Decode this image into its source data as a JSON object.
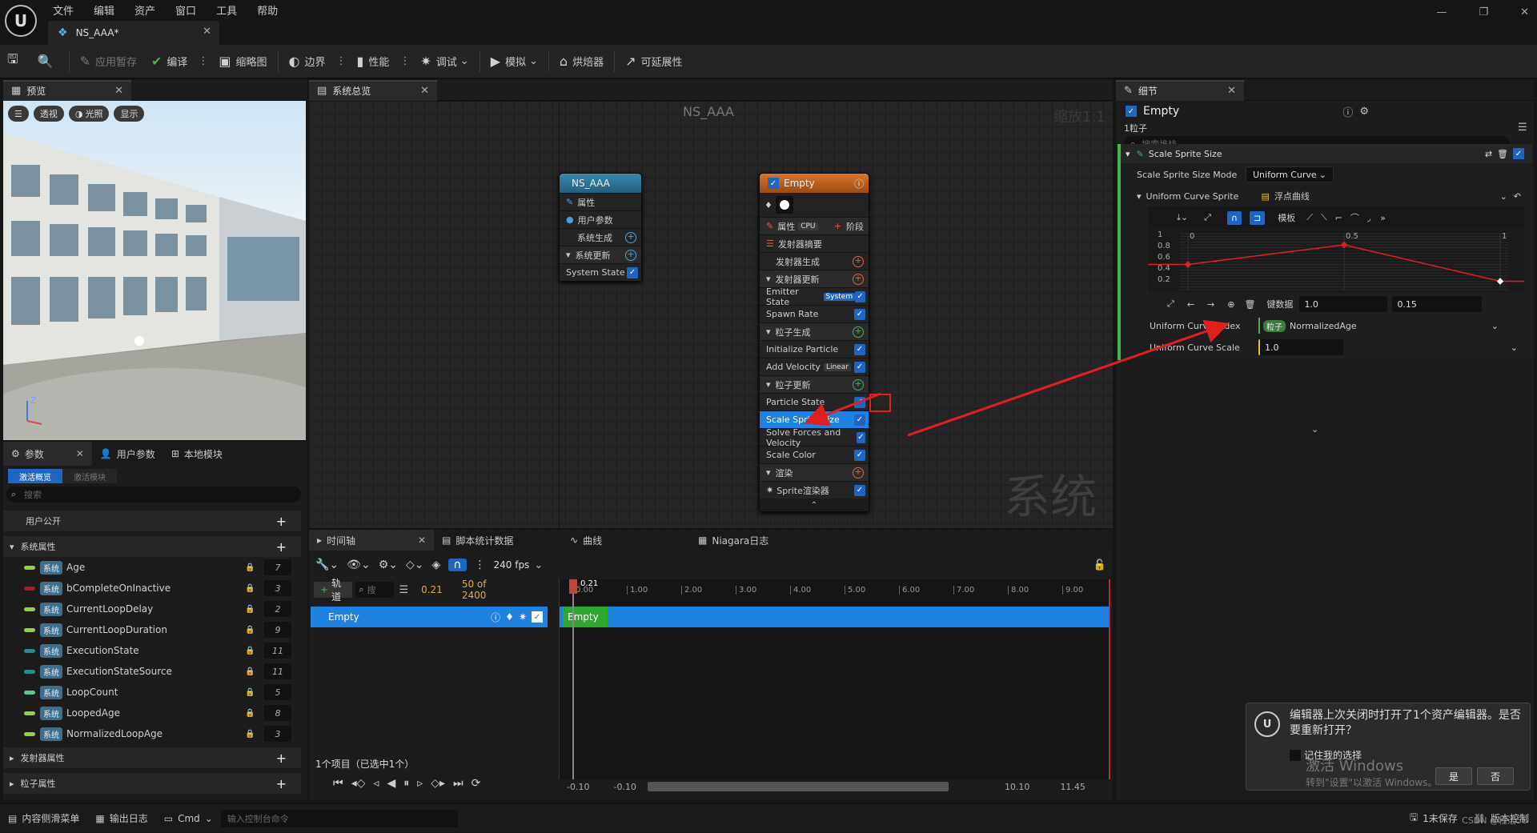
{
  "menu": [
    "文件",
    "编辑",
    "资产",
    "窗口",
    "工具",
    "帮助"
  ],
  "doc_tab": "NS_AAA*",
  "toolbar": [
    {
      "label": "应用暂存",
      "icon": "apply-icon",
      "dim": true
    },
    {
      "label": "编译",
      "icon": "compile-icon",
      "dim": false
    },
    {
      "label": "缩略图",
      "icon": "thumbnail-icon",
      "dim": false
    },
    {
      "label": "边界",
      "icon": "bounds-icon",
      "dim": false
    },
    {
      "label": "性能",
      "icon": "performance-icon",
      "dim": false
    },
    {
      "label": "调试",
      "icon": "debug-icon",
      "dim": false
    },
    {
      "label": "模拟",
      "icon": "simulate-icon",
      "dim": false
    },
    {
      "label": "烘焙器",
      "icon": "baker-icon",
      "dim": false
    },
    {
      "label": "可延展性",
      "icon": "scalability-icon",
      "dim": false
    }
  ],
  "preview": {
    "tab": "预览",
    "buttons": [
      "透视",
      "光照",
      "显示"
    ],
    "axis_z": "Z"
  },
  "params": {
    "tabs": [
      "参数",
      "用户参数",
      "本地模块"
    ],
    "subtabs": [
      "激活概览",
      "激活模块"
    ],
    "search_placeholder": "搜索",
    "sections": [
      "用户公开",
      "系统属性",
      "发射器属性",
      "粒子属性"
    ],
    "tag": "系统",
    "rows": [
      {
        "name": "Age",
        "value": "7",
        "color": "#8bd34a"
      },
      {
        "name": "bCompleteOnInactive",
        "value": "3",
        "color": "#b01a1a"
      },
      {
        "name": "CurrentLoopDelay",
        "value": "2",
        "color": "#8bd34a"
      },
      {
        "name": "CurrentLoopDuration",
        "value": "9",
        "color": "#8bd34a"
      },
      {
        "name": "ExecutionState",
        "value": "11",
        "color": "#1f8f8f"
      },
      {
        "name": "ExecutionStateSource",
        "value": "11",
        "color": "#1f8f8f"
      },
      {
        "name": "LoopCount",
        "value": "5",
        "color": "#4ad38b"
      },
      {
        "name": "LoopedAge",
        "value": "8",
        "color": "#8bd34a"
      },
      {
        "name": "NormalizedLoopAge",
        "value": "3",
        "color": "#8bd34a"
      }
    ]
  },
  "graph": {
    "tab": "系统总览",
    "title": "NS_AAA",
    "zoom": "缩放1:1",
    "watermark": "系统",
    "system_node": {
      "title": "NS_AAA",
      "rows": [
        "属性",
        "用户参数",
        "系统生成",
        "系统更新",
        "System State"
      ]
    },
    "emitter_node": {
      "title": "Empty",
      "props": "属性",
      "cpu": "CPU",
      "stage": "阶段",
      "summary": "发射器摘要",
      "rows": [
        {
          "label": "发射器生成",
          "kind": "section-o"
        },
        {
          "label": "发射器更新",
          "kind": "head-o"
        },
        {
          "label": "Emitter State",
          "badge": "System",
          "kind": "check"
        },
        {
          "label": "Spawn Rate",
          "kind": "check"
        },
        {
          "label": "粒子生成",
          "kind": "head-g"
        },
        {
          "label": "Initialize Particle",
          "kind": "check"
        },
        {
          "label": "Add Velocity",
          "badge2": "Linear",
          "kind": "check"
        },
        {
          "label": "粒子更新",
          "kind": "head-g"
        },
        {
          "label": "Particle State",
          "kind": "check"
        },
        {
          "label": "Scale Sprite Size",
          "kind": "selected"
        },
        {
          "label": "Solve Forces and Velocity",
          "kind": "check"
        },
        {
          "label": "Scale Color",
          "kind": "check"
        },
        {
          "label": "渲染",
          "kind": "head-o"
        },
        {
          "label": "Sprite渲染器",
          "kind": "check"
        }
      ]
    }
  },
  "timeline": {
    "tabs": [
      "时间轴",
      "脚本统计数据",
      "曲线",
      "Niagara日志"
    ],
    "fps": "240 fps",
    "track_btn": "轨道",
    "search": "搜",
    "time": "0.21",
    "frames": "50 of 2400",
    "playhead": "0.21",
    "ticks": [
      "0.00",
      "1.00",
      "2.00",
      "3.00",
      "4.00",
      "5.00",
      "6.00",
      "7.00",
      "8.00",
      "9.00"
    ],
    "track": "Empty",
    "bar": "Empty",
    "items": "1个项目（已选中1个）",
    "range": [
      "-0.10",
      "-0.10",
      "10.10",
      "11.45"
    ]
  },
  "details": {
    "tab": "细节",
    "title": "Empty",
    "sub": "1粒子",
    "search_placeholder": "搜索堆栈",
    "module": "Scale Sprite Size",
    "mode_label": "Scale Sprite Size Mode",
    "mode_value": "Uniform Curve",
    "curve_label": "Uniform Curve Sprite",
    "curve_value": "浮点曲线",
    "template": "模板",
    "y_ticks": [
      "1",
      "0.8",
      "0.6",
      "0.4",
      "0.2"
    ],
    "x_ticks": [
      "0",
      "0.5",
      "1"
    ],
    "key_label": "键数据",
    "key_time": "1.0",
    "key_value": "0.15",
    "index_label": "Uniform Curve Index",
    "index_tag": "粒子",
    "index_value": "NormalizedAge",
    "scale_label": "Uniform Curve Scale",
    "scale_value": "1.0",
    "curve_points": [
      [
        0,
        0.45
      ],
      [
        0.5,
        0.8
      ],
      [
        1,
        0.15
      ]
    ]
  },
  "statusbar": {
    "items": [
      "内容侧滑菜单",
      "输出日志",
      "Cmd"
    ],
    "cmd_placeholder": "输入控制台命令",
    "unsaved": "1未保存",
    "source_control": "版本控制"
  },
  "notification": {
    "text": "编辑器上次关闭时打开了1个资产编辑器。是否要重新打开？",
    "remember": "记住我的选择",
    "yes": "是",
    "no": "否",
    "watermark1": "激活 Windows",
    "watermark2": "转到\"设置\"以激活 Windows。",
    "csdn": "CSDN @程洁56"
  },
  "colors": {
    "accent": "#1f66c2",
    "arrow": "#e02020",
    "node_system": "#2e6d8e",
    "node_emitter": "#c9651e"
  }
}
